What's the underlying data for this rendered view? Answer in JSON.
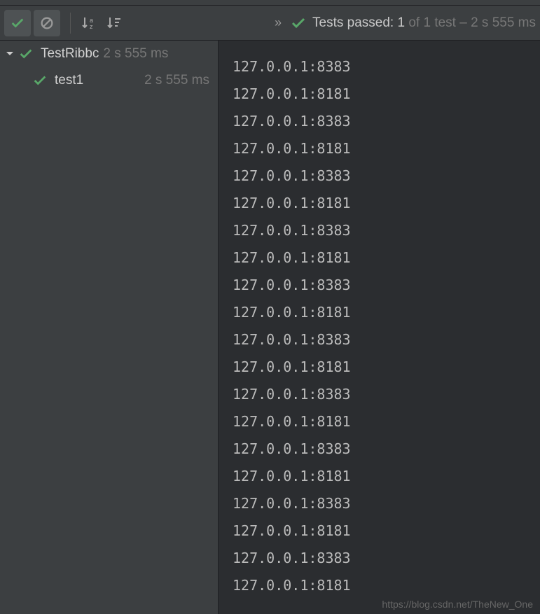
{
  "toolbar": {
    "expand_label": "»"
  },
  "status": {
    "prefix": "Tests passed:",
    "count": "1",
    "suffix": "of 1 test – 2 s 555 ms"
  },
  "tree": {
    "root": {
      "name": "TestRibbc",
      "time": "2 s 555 ms"
    },
    "child": {
      "name": "test1",
      "time": "2 s 555 ms"
    }
  },
  "output": [
    "127.0.0.1:8383",
    "127.0.0.1:8181",
    "127.0.0.1:8383",
    "127.0.0.1:8181",
    "127.0.0.1:8383",
    "127.0.0.1:8181",
    "127.0.0.1:8383",
    "127.0.0.1:8181",
    "127.0.0.1:8383",
    "127.0.0.1:8181",
    "127.0.0.1:8383",
    "127.0.0.1:8181",
    "127.0.0.1:8383",
    "127.0.0.1:8181",
    "127.0.0.1:8383",
    "127.0.0.1:8181",
    "127.0.0.1:8383",
    "127.0.0.1:8181",
    "127.0.0.1:8383",
    "127.0.0.1:8181"
  ],
  "watermark": "https://blog.csdn.net/TheNew_One"
}
